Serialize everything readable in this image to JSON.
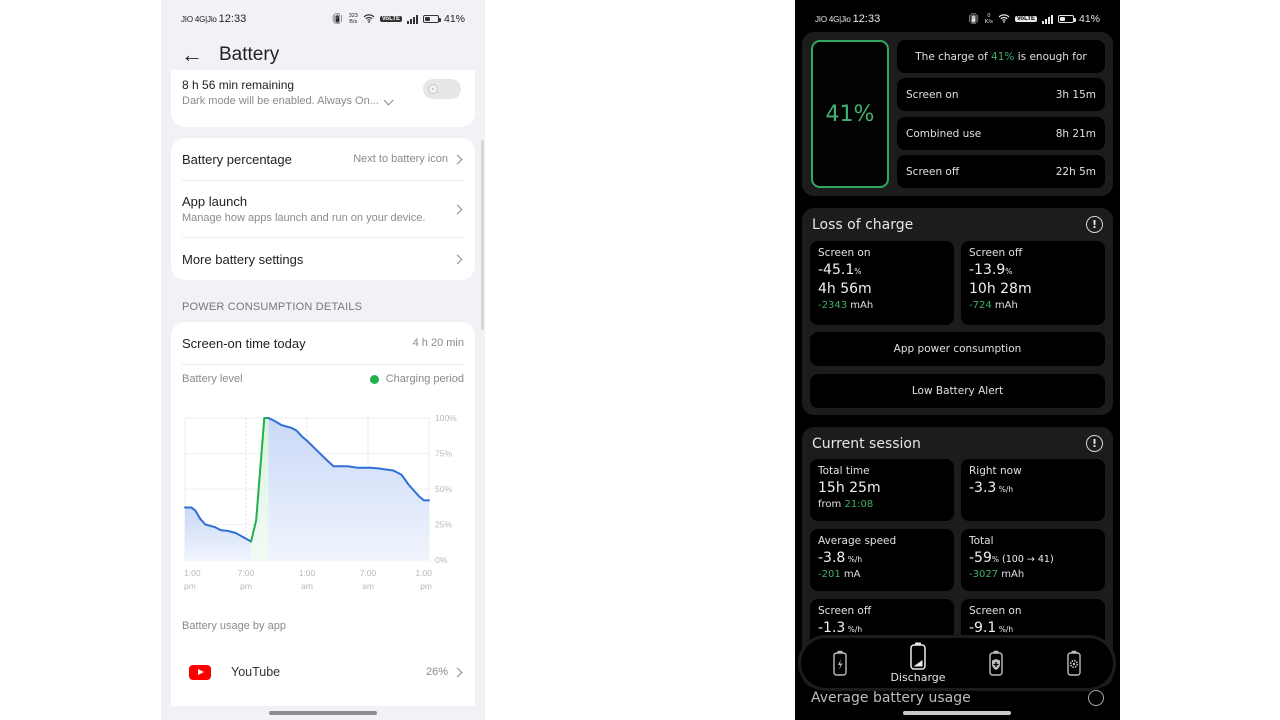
{
  "left": {
    "status": {
      "carrier": "JIO 4G|Jio",
      "time": "12:33",
      "net_speed_value": "323",
      "net_speed_unit": "B/s",
      "volte": "VoLTE",
      "battery": "41%"
    },
    "header": {
      "title": "Battery",
      "back_icon": "arrow-left-icon"
    },
    "dark_mode_card": {
      "title": "8 h 56 min remaining",
      "subtitle": "Dark mode will be enabled. Always On...",
      "toggle_on": false
    },
    "settings": [
      {
        "label": "Battery percentage",
        "value": "Next to battery icon"
      },
      {
        "label": "App launch",
        "subtitle": "Manage how apps launch and run on your device."
      },
      {
        "label": "More battery settings"
      }
    ],
    "section_title": "POWER CONSUMPTION DETAILS",
    "screen_on": {
      "label": "Screen-on time today",
      "value": "4 h 20 min"
    },
    "battery_level_label": "Battery level",
    "charging_legend": "Charging period",
    "colors": {
      "discharge_line": "#2f6fd8",
      "charge_line": "#22b04b",
      "legend_dot": "#22b04b"
    },
    "usage_title": "Battery usage by app",
    "apps": [
      {
        "name": "YouTube",
        "percent": "26%",
        "icon": "youtube-icon"
      }
    ]
  },
  "chart_data": {
    "type": "line",
    "title": "Battery level",
    "xlabel": "",
    "ylabel": "",
    "x_ticks": [
      "1:00 pm",
      "7:00 pm",
      "1:00 am",
      "7:00 am",
      "1:00 pm"
    ],
    "y_ticks": [
      "100%",
      "75%",
      "50%",
      "25%",
      "0%"
    ],
    "ylim": [
      0,
      100
    ],
    "xlim_hours": [
      0,
      24
    ],
    "grid": true,
    "legend": {
      "entries": [
        "Charging period"
      ],
      "placement": "top-right"
    },
    "series": [
      {
        "name": "Discharge",
        "points": [
          [
            0,
            37
          ],
          [
            0.6,
            37
          ],
          [
            1,
            35
          ],
          [
            1.5,
            29
          ],
          [
            2,
            25
          ],
          [
            3,
            23
          ],
          [
            3.5,
            21
          ],
          [
            4.2,
            20.5
          ],
          [
            5,
            19
          ],
          [
            5.5,
            17
          ],
          [
            6.5,
            13
          ]
        ]
      },
      {
        "name": "Charging period",
        "points": [
          [
            6.5,
            13
          ],
          [
            7,
            28
          ],
          [
            7.8,
            100
          ],
          [
            8.2,
            100
          ]
        ]
      },
      {
        "name": "Discharge",
        "points": [
          [
            8.2,
            100
          ],
          [
            8.8,
            98
          ],
          [
            9.5,
            95
          ],
          [
            10.5,
            93
          ],
          [
            11,
            91
          ],
          [
            11.5,
            87
          ],
          [
            12,
            84
          ],
          [
            13,
            77
          ],
          [
            14,
            70
          ],
          [
            14.6,
            66
          ],
          [
            16,
            66
          ],
          [
            17,
            65
          ],
          [
            18.2,
            65
          ],
          [
            19,
            64.5
          ],
          [
            19.5,
            64
          ],
          [
            20.5,
            63
          ],
          [
            21.3,
            60
          ],
          [
            22,
            53
          ],
          [
            23,
            45
          ],
          [
            23.5,
            42
          ],
          [
            24,
            42
          ]
        ]
      }
    ]
  },
  "right": {
    "status": {
      "carrier": "JIO 4G|Jio",
      "time": "12:33",
      "net_speed_value": "0",
      "net_speed_unit": "K/s",
      "volte": "VoLTE",
      "battery": "41%"
    },
    "battery_percent": "41%",
    "enough_prefix": "The charge of ",
    "enough_value": "41%",
    "enough_suffix": " is enough for",
    "estimates": [
      {
        "label": "Screen on",
        "value": "3h 15m"
      },
      {
        "label": "Combined use",
        "value": "8h 21m"
      },
      {
        "label": "Screen off",
        "value": "22h 5m"
      }
    ],
    "loss": {
      "title": "Loss of charge",
      "screen_on": {
        "label": "Screen on",
        "percent": "-45.1",
        "unit": "%",
        "duration": "4h 56m",
        "mah": "-2343",
        "mah_unit": " mAh"
      },
      "screen_off": {
        "label": "Screen off",
        "percent": "-13.9",
        "unit": "%",
        "duration": "10h 28m",
        "mah": "-724",
        "mah_unit": " mAh"
      },
      "app_button": "App power consumption",
      "alert_button": "Low Battery Alert"
    },
    "session": {
      "title": "Current session",
      "total_time": {
        "label": "Total time",
        "value": "15h 25m",
        "from_prefix": "from ",
        "from_value": "21:08"
      },
      "right_now": {
        "label": "Right now",
        "value": "-3.3",
        "unit": " %/h"
      },
      "avg_speed": {
        "label": "Average speed",
        "value": "-3.8",
        "unit": " %/h",
        "ma": "-201",
        "ma_unit": " mA"
      },
      "total": {
        "label": "Total",
        "value": "-59",
        "unit": "%",
        "range": " (100 → 41)",
        "mah": "-3027",
        "mah_unit": " mAh"
      },
      "screen_off": {
        "label": "Screen off",
        "value": "-1.3",
        "unit": " %/h"
      },
      "screen_on": {
        "label": "Screen on",
        "value": "-9.1",
        "unit": " %/h"
      }
    },
    "nav": [
      {
        "id": "charge",
        "label": "",
        "icon": "battery-charging-icon"
      },
      {
        "id": "discharge",
        "label": "Discharge",
        "icon": "battery-discharge-icon",
        "active": true
      },
      {
        "id": "health",
        "label": "",
        "icon": "battery-health-icon"
      },
      {
        "id": "settings",
        "label": "",
        "icon": "battery-settings-icon"
      }
    ],
    "peek_title": "Average battery usage",
    "accent": "#3fae6a"
  }
}
